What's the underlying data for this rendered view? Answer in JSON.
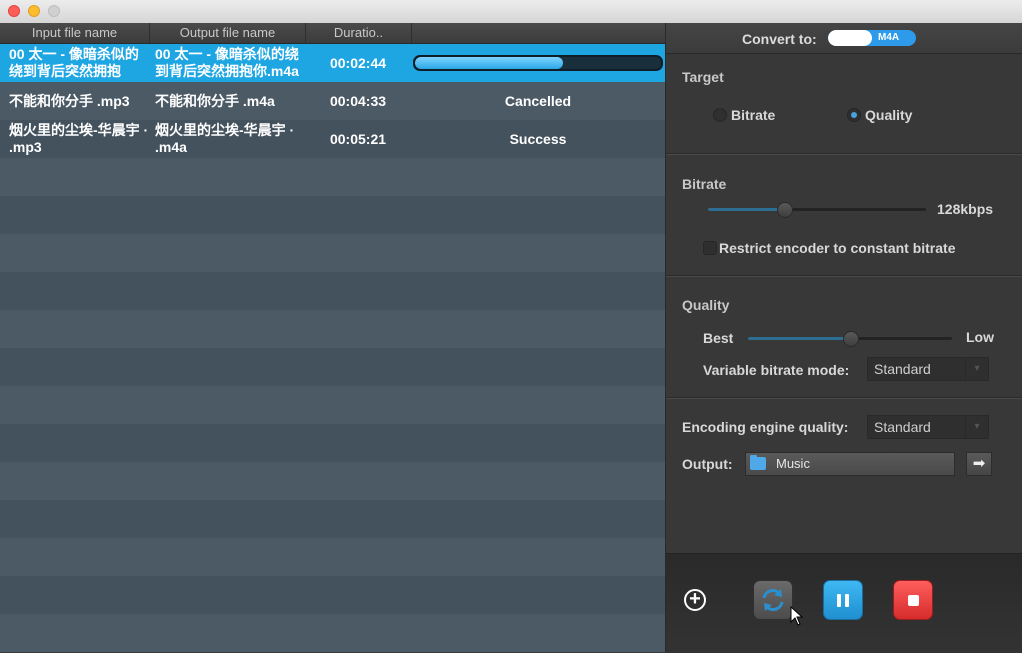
{
  "window": {
    "controls": [
      "close",
      "minimize",
      "zoom"
    ]
  },
  "table": {
    "columns": [
      "Input file name",
      "Output file name",
      "Duratio.."
    ],
    "rows": [
      {
        "input": "00 太一 - 像暗杀似的绕到背后突然拥抱",
        "output": "00 太一 - 像暗杀似的绕到背后突然拥抱你.m4a",
        "duration": "00:02:44",
        "status": "",
        "progress": 0.6,
        "selected": true
      },
      {
        "input": "不能和你分手 .mp3",
        "output": "不能和你分手 .m4a",
        "duration": "00:04:33",
        "status": "Cancelled",
        "selected": false
      },
      {
        "input": "烟火里的尘埃-华晨宇 · .mp3",
        "output": "烟火里的尘埃-华晨宇 · .m4a",
        "duration": "00:05:21",
        "status": "Success",
        "selected": false
      }
    ]
  },
  "settings": {
    "convert_to_label": "Convert to:",
    "format": "M4A",
    "target": {
      "title": "Target",
      "options": [
        "Bitrate",
        "Quality"
      ],
      "selected": "Quality"
    },
    "bitrate": {
      "title": "Bitrate",
      "value": "128kbps",
      "slider_level": 0.35,
      "restrict_label": "Restrict encoder to constant bitrate",
      "restrict_checked": false
    },
    "quality": {
      "title": "Quality",
      "best_label": "Best",
      "low_label": "Low",
      "slider_level": 0.5,
      "vbr_label": "Variable bitrate mode:",
      "vbr_value": "Standard"
    },
    "encoding": {
      "label": "Encoding engine quality:",
      "value": "Standard"
    },
    "output": {
      "label": "Output:",
      "folder": "Music"
    }
  },
  "toolbar": {
    "buttons": [
      "add",
      "convert",
      "pause",
      "stop"
    ]
  },
  "colors": {
    "accent": "#1ea6e3",
    "stop": "#e03a3a"
  }
}
